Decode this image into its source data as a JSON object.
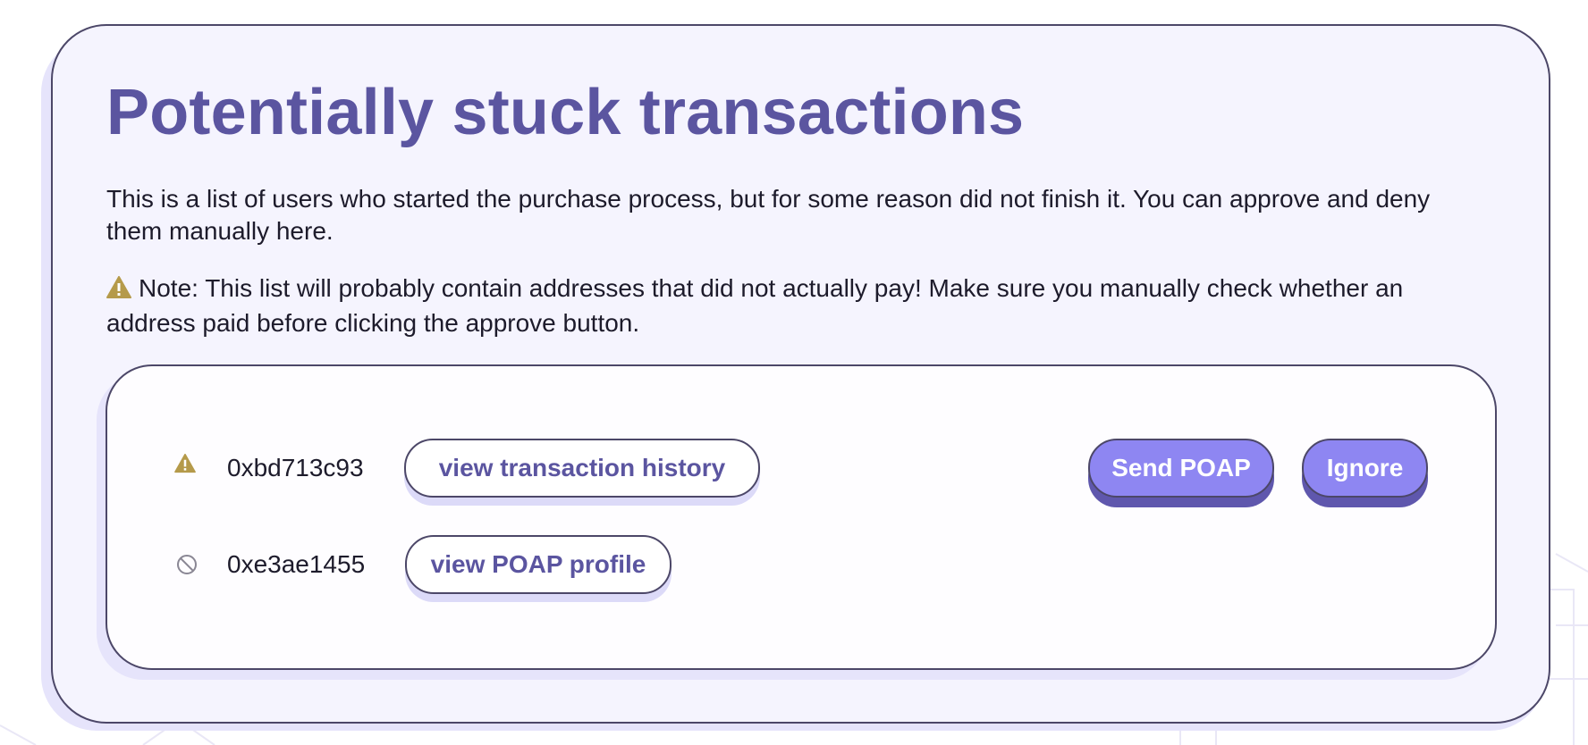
{
  "page_title": "Potentially stuck transactions",
  "description": "This is a list of users who started the purchase process, but for some reason did not finish it. You can approve and deny them manually here.",
  "note": "Note: This list will probably contain addresses that did not actually pay! Make sure you manually check whether an address paid before clicking the approve button.",
  "colors": {
    "accent": "#5b55a0",
    "button_fill": "#8e86f2",
    "warning": "#b59a4a",
    "card_background": "#f5f4fe"
  },
  "rows": [
    {
      "status_icon": "warning-icon",
      "address": "0xbd713c93",
      "link_label": "view transaction history",
      "send_label": "Send POAP",
      "ignore_label": "Ignore"
    },
    {
      "status_icon": "blocked-icon",
      "address": "0xe3ae1455",
      "link_label": "view POAP profile"
    }
  ]
}
